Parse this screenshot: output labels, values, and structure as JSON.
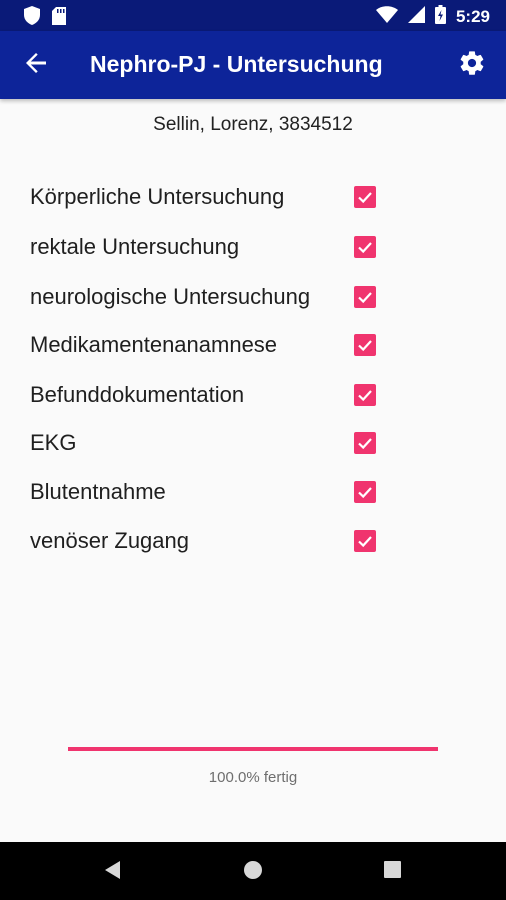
{
  "status_bar": {
    "time": "5:29",
    "icons_left": [
      "shield-icon",
      "sd-card-icon"
    ],
    "icons_right": [
      "wifi-icon",
      "cell-signal-icon",
      "battery-charging-icon"
    ]
  },
  "app_bar": {
    "title": "Nephro-PJ - Untersuchung",
    "back_icon": "arrow-back-icon",
    "settings_icon": "gear-icon",
    "color": "#0d2499"
  },
  "patient": {
    "text": "Sellin, Lorenz, 3834512"
  },
  "checklist": [
    {
      "label": "Körperliche Untersuchung",
      "checked": true
    },
    {
      "label": "rektale Untersuchung",
      "checked": true
    },
    {
      "label": "neurologische Untersuchung",
      "checked": true
    },
    {
      "label": "Medikamentenanamnese",
      "checked": true
    },
    {
      "label": "Befunddokumentation",
      "checked": true
    },
    {
      "label": "EKG",
      "checked": true
    },
    {
      "label": "Blutentnahme",
      "checked": true
    },
    {
      "label": "venöser Zugang",
      "checked": true
    }
  ],
  "progress": {
    "value": 1.0,
    "text": "100.0% fertig",
    "color": "#f0346e"
  },
  "nav_bar": {
    "icons": [
      "back-triangle-icon",
      "home-circle-icon",
      "recents-square-icon"
    ]
  }
}
